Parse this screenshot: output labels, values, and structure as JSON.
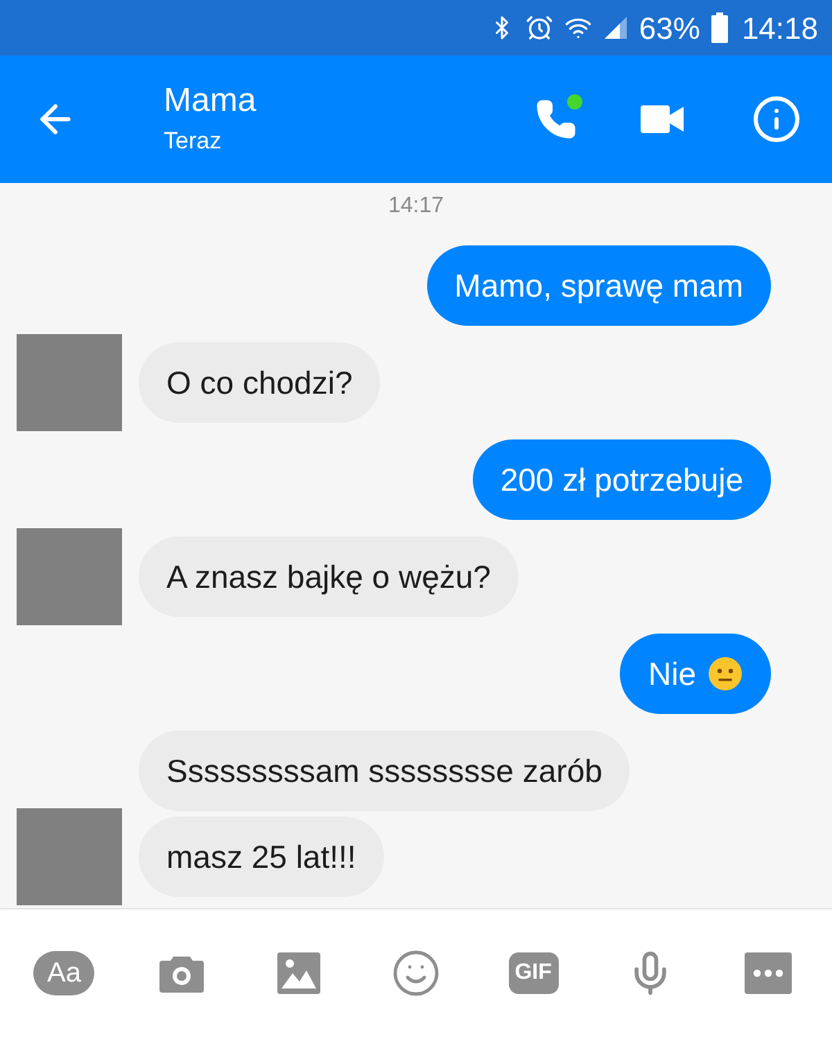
{
  "status_bar": {
    "battery_percent": "63%",
    "time": "14:18"
  },
  "header": {
    "name": "Mama",
    "status": "Teraz",
    "call_online": true
  },
  "timestamp": "14:17",
  "messages": [
    {
      "kind": "sent",
      "text": "Mamo, sprawę mam"
    },
    {
      "kind": "received",
      "text": "O co chodzi?",
      "avatar": true
    },
    {
      "kind": "sent",
      "text": "200 zł potrzebuje"
    },
    {
      "kind": "received",
      "text": "A znasz bajkę o wężu?",
      "avatar": true
    },
    {
      "kind": "sent",
      "text": "Nie",
      "emoji": true
    },
    {
      "kind": "received",
      "text": "Sssssssssam sssssssse zarób",
      "avatar": false
    },
    {
      "kind": "received",
      "text": "masz 25 lat!!!",
      "avatar": true,
      "grouped": true
    }
  ],
  "toolbar": [
    {
      "kind": "text",
      "label": "Aa"
    },
    {
      "kind": "camera"
    },
    {
      "kind": "image"
    },
    {
      "kind": "emoji"
    },
    {
      "kind": "gif",
      "label": "GIF"
    },
    {
      "kind": "mic"
    },
    {
      "kind": "more"
    }
  ]
}
